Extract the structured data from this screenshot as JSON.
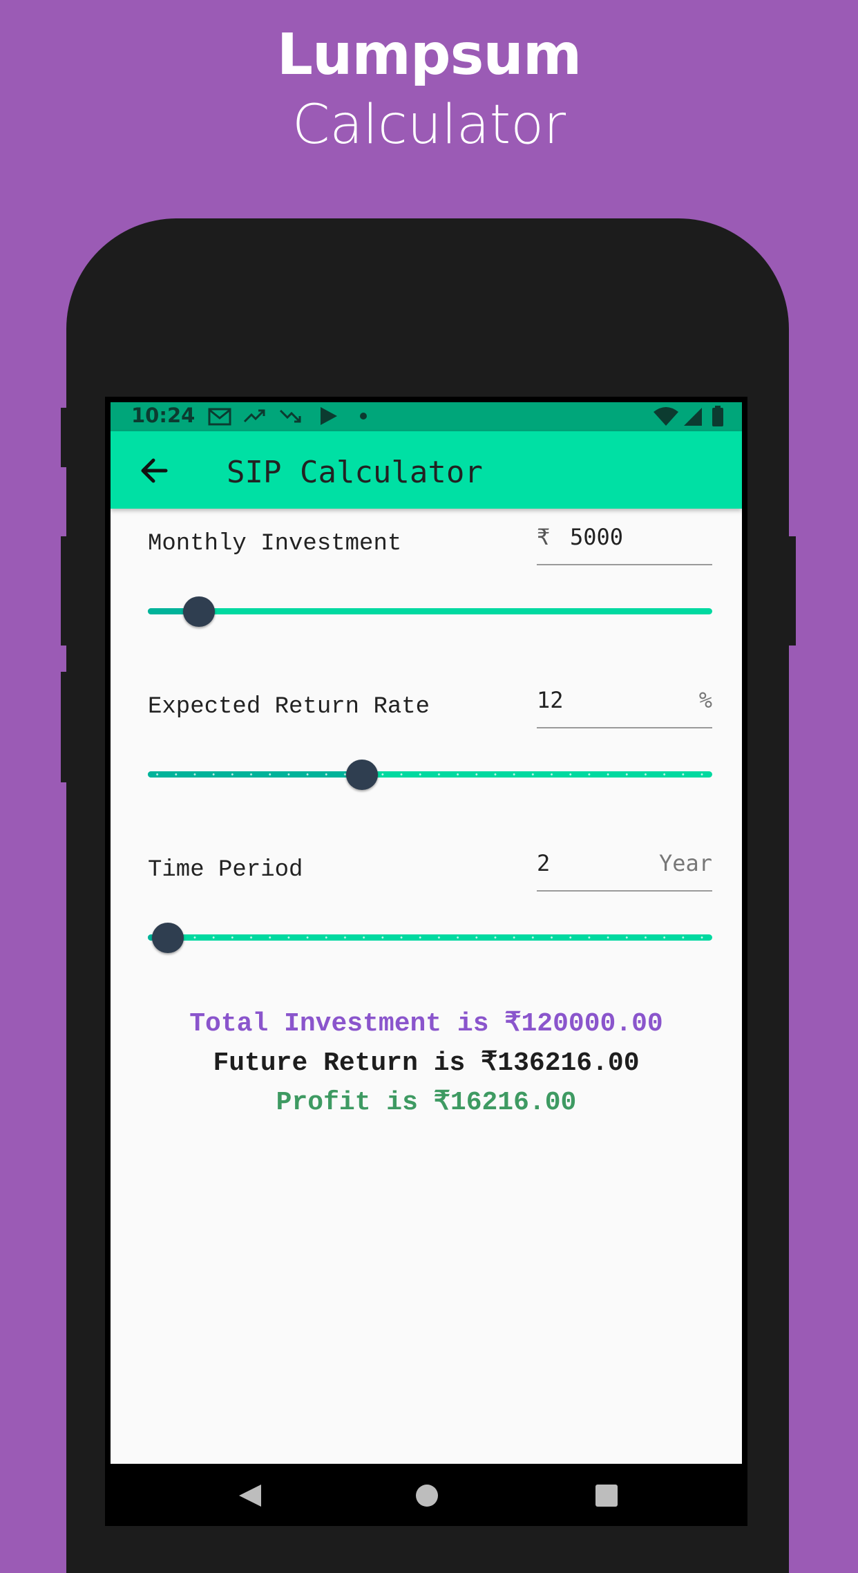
{
  "promo": {
    "title": "Lumpsum",
    "subtitle": "Calculator"
  },
  "status_bar": {
    "time": "10:24"
  },
  "app_bar": {
    "title": "SIP Calculator",
    "back_icon": "arrow-left-icon"
  },
  "fields": {
    "monthly_investment": {
      "label": "Monthly Investment",
      "prefix": "₹",
      "value": "5000",
      "slider_fraction": 0.09
    },
    "return_rate": {
      "label": "Expected Return Rate",
      "value": "12",
      "suffix": "%",
      "slider_fraction": 0.38
    },
    "time_period": {
      "label": "Time Period",
      "value": "2",
      "suffix": "Year",
      "slider_fraction": 0.035
    }
  },
  "results": {
    "total_investment": "Total Investment is ₹120000.00",
    "future_return": "Future Return is ₹136216.00",
    "profit": "Profit is ₹16216.00"
  },
  "colors": {
    "background": "#9b5bb5",
    "app_bar": "#00e0a4",
    "status_bar": "#00a67a",
    "slider_thumb": "#2f3e50",
    "total_investment": "#8a55cc",
    "future_return": "#1e1e1e",
    "profit": "#3e9a62"
  }
}
